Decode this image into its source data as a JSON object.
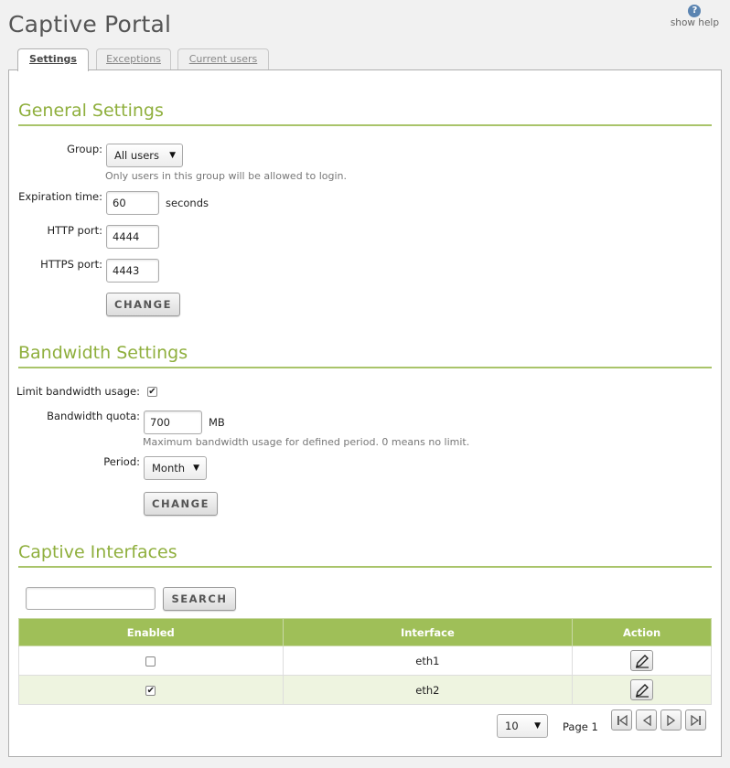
{
  "page": {
    "title": "Captive Portal",
    "help_label": "show help",
    "help_glyph": "?"
  },
  "tabs": [
    {
      "label": "Settings",
      "active": true
    },
    {
      "label": "Exceptions",
      "active": false
    },
    {
      "label": "Current users",
      "active": false
    }
  ],
  "general": {
    "title": "General Settings",
    "group_label": "Group:",
    "group_value": "All users",
    "group_hint": "Only users in this group will be allowed to login.",
    "expiration_label": "Expiration time:",
    "expiration_value": "60",
    "expiration_unit": "seconds",
    "http_label": "HTTP port:",
    "http_value": "4444",
    "https_label": "HTTPS port:",
    "https_value": "4443",
    "change_label": "CHANGE"
  },
  "bandwidth": {
    "title": "Bandwidth Settings",
    "limit_label": "Limit bandwidth usage:",
    "limit_checked": true,
    "quota_label": "Bandwidth quota:",
    "quota_value": "700",
    "quota_unit": "MB",
    "quota_hint": "Maximum bandwidth usage for defined period. 0 means no limit.",
    "period_label": "Period:",
    "period_value": "Month",
    "change_label": "CHANGE"
  },
  "interfaces": {
    "title": "Captive Interfaces",
    "search_value": "",
    "search_label": "SEARCH",
    "columns": [
      "Enabled",
      "Interface",
      "Action"
    ],
    "rows": [
      {
        "enabled": false,
        "interface": "eth1"
      },
      {
        "enabled": true,
        "interface": "eth2"
      }
    ],
    "page_size": "10",
    "page_label": "Page 1"
  },
  "glyphs": {
    "check": "✔",
    "dropdown": "▼"
  },
  "icons": {
    "edit": "pencil-icon",
    "first": "first-page-icon",
    "prev": "previous-page-icon",
    "next": "next-page-icon",
    "last": "last-page-icon"
  },
  "colors": {
    "accent": "#8faf3d",
    "header_bg": "#9fbf58",
    "row_alt": "#eef4e0"
  }
}
